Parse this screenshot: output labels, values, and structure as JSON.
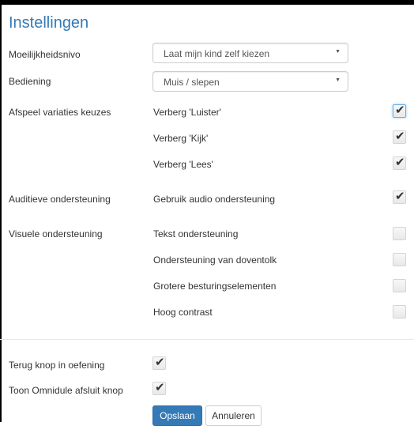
{
  "title": "Instellingen",
  "fields": {
    "difficulty": {
      "label": "Moeilijkheidsnivo",
      "value": "Laat mijn kind zelf kiezen"
    },
    "control": {
      "label": "Bediening",
      "value": "Muis / slepen"
    },
    "playback": {
      "label": "Afspeel variaties keuzes",
      "options": [
        {
          "label": "Verberg 'Luister'",
          "checked": true
        },
        {
          "label": "Verberg 'Kijk'",
          "checked": true
        },
        {
          "label": "Verberg 'Lees'",
          "checked": true
        }
      ]
    },
    "audio": {
      "label": "Auditieve ondersteuning",
      "options": [
        {
          "label": "Gebruik audio ondersteuning",
          "checked": true
        }
      ]
    },
    "visual": {
      "label": "Visuele ondersteuning",
      "options": [
        {
          "label": "Tekst ondersteuning",
          "checked": false
        },
        {
          "label": "Ondersteuning van doventolk",
          "checked": false
        },
        {
          "label": "Grotere besturingselementen",
          "checked": false
        },
        {
          "label": "Hoog contrast",
          "checked": false
        }
      ]
    },
    "back_button": {
      "label": "Terug knop in oefening",
      "checked": true
    },
    "close_button": {
      "label": "Toon Omnidule afsluit knop",
      "checked": true
    }
  },
  "buttons": {
    "save": "Opslaan",
    "cancel": "Annuleren"
  },
  "icons": {
    "check": "checkmark-icon",
    "select_arrow": "caret-down-icon"
  },
  "colors": {
    "title": "#337ab7",
    "primary": "#337ab7"
  }
}
